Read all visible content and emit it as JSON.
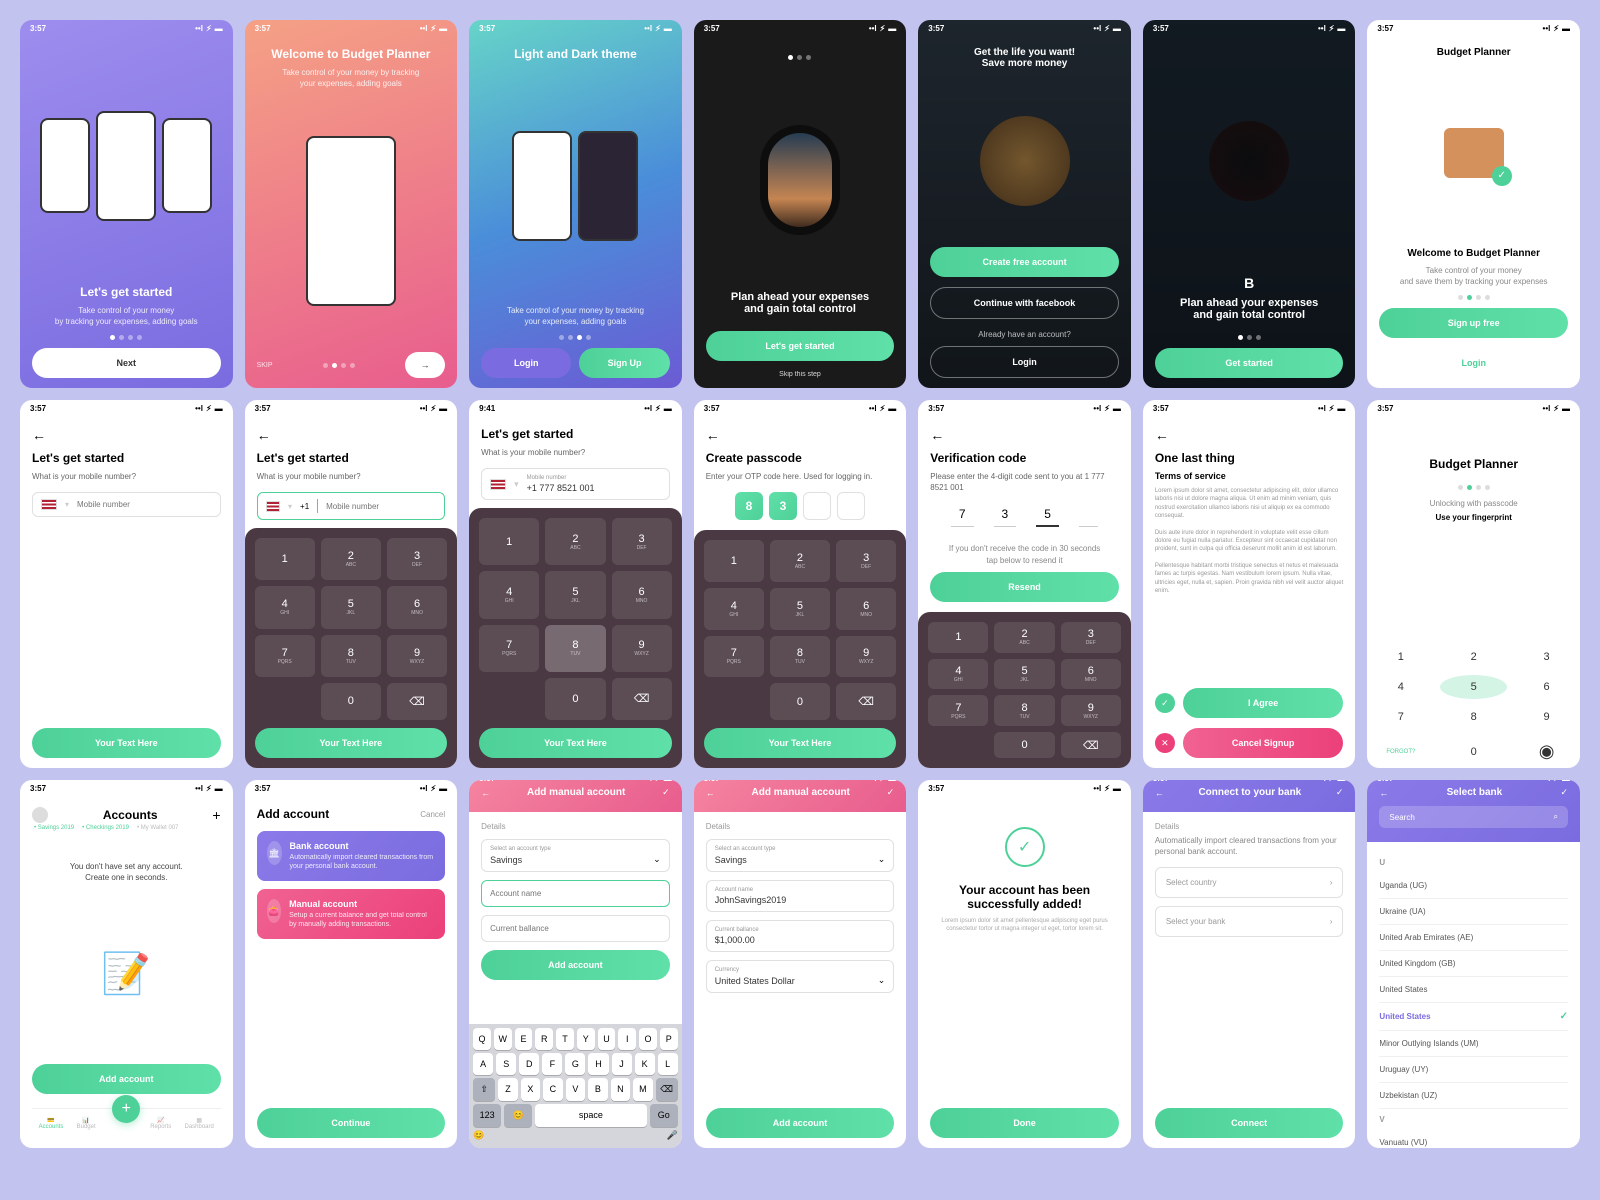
{
  "time": "3:57",
  "time_alt": "9:41",
  "r1": {
    "s1": {
      "title": "Let's get started",
      "subtitle": "Take control of your money\nby tracking your expenses, adding goals",
      "btn": "Next"
    },
    "s2": {
      "title": "Welcome to Budget Planner",
      "subtitle": "Take control of your money by tracking\nyour expenses, adding goals",
      "skip": "SKIP"
    },
    "s3": {
      "title": "Light and Dark theme",
      "subtitle": "Take control of your money by tracking\nyour expenses, adding goals",
      "login": "Login",
      "signup": "Sign Up"
    },
    "s4": {
      "title": "Plan ahead your expenses\nand gain total control",
      "btn": "Let's get started",
      "skip": "Skip this step"
    },
    "s5": {
      "title": "Get the life you want!\nSave more money",
      "btn_create": "Create free account",
      "btn_fb": "Continue with facebook",
      "already": "Already have an account?",
      "login": "Login"
    },
    "s6": {
      "title": "Plan ahead your expenses\nand gain total control",
      "btn": "Get started",
      "letter": "B"
    },
    "s7": {
      "app": "Budget Planner",
      "title": "Welcome to Budget Planner",
      "subtitle": "Take control of your money\nand save them by tracking your expenses",
      "signup": "Sign up free",
      "login": "Login"
    }
  },
  "r2": {
    "s1": {
      "title": "Let's get started",
      "q": "What is your mobile number?",
      "ph": "Mobile number",
      "btn": "Your Text Here"
    },
    "s2": {
      "title": "Let's get started",
      "q": "What is your mobile number?",
      "prefix": "+1",
      "ph": "Mobile number",
      "btn": "Your Text Here"
    },
    "s3": {
      "title": "Let's get started",
      "q": "What is your mobile number?",
      "label": "Mobile number",
      "value": "+1 777 8521 001",
      "btn": "Your Text Here"
    },
    "s4": {
      "title": "Create passcode",
      "subtitle": "Enter your OTP code here. Used for logging in.",
      "d1": "8",
      "d2": "3",
      "btn": "Your Text Here"
    },
    "s5": {
      "title": "Verification code",
      "subtitle": "Please enter the 4-digit code sent to you at 1 777 8521 001",
      "d1": "7",
      "d2": "3",
      "d3": "5",
      "hint": "If you don't receive the code in 30 seconds\ntap below to resend it",
      "btn": "Resend"
    },
    "s6": {
      "title": "One last thing",
      "sub": "Terms of service",
      "agree": "I Agree",
      "cancel": "Cancel Signup",
      "p1": "Lorem ipsum dolor sit amet, consectetur adipiscing elit, dolor ullamco laboris nisi ut dolore magna aliqua. Ut enim ad minim veniam, quis nostrud exercitation ullamco laboris nisi ut aliquip ex ea commodo consequat.",
      "p2": "Duis aute irure dolor in reprehenderit in voluptate velit esse cillum dolore eu fugiat nulla pariatur. Excepteur sint occaecat cupidatat non proident, sunt in culpa qui officia deserunt mollit anim id est laborum.",
      "p3": "Pellentesque habitant morbi tristique senectus et netus et malesuada fames ac turpis egestas. Nam vestibulum lorem ipsum. Nulla vitae, ultricies eget, nulla et, sapien. Proin gravida nibh vel velit auctor aliquet enim."
    },
    "s7": {
      "app": "Budget Planner",
      "hint1": "Unlocking with passcode",
      "hint2": "Use your fingerprint",
      "forgot": "FORGOT?"
    }
  },
  "r3": {
    "s1": {
      "title": "Accounts",
      "empty": "You don't have set any account.\nCreate one in seconds.",
      "btn": "Add account",
      "chip1": "• Savings 2019",
      "chip2": "• Checkings 2019",
      "chip3": "• My Wallet 007",
      "tabs": [
        "Accounts",
        "Budget",
        "Reports",
        "Dashboard"
      ]
    },
    "s2": {
      "title": "Add account",
      "cancel": "Cancel",
      "bank_t": "Bank account",
      "bank_d": "Automatically import cleared transactions from your personal bank account.",
      "manual_t": "Manual account",
      "manual_d": "Setup a current balance and get total control by manually adding transactions.",
      "btn": "Continue"
    },
    "s3": {
      "title": "Add manual account",
      "details": "Details",
      "type_label": "Select an account type",
      "type": "Savings",
      "name_ph": "Account name",
      "bal_ph": "Current ballance",
      "btn": "Add account"
    },
    "s4": {
      "title": "Add manual account",
      "details": "Details",
      "type_label": "Select an account type",
      "type": "Savings",
      "name_label": "Account name",
      "name": "JohnSavings2019",
      "bal_label": "Current ballance",
      "bal": "$1,000.00",
      "cur_label": "Currency",
      "cur": "United States Dollar",
      "btn": "Add account"
    },
    "s5": {
      "title": "Your account has been\nsuccessfully added!",
      "desc": "Lorem ipsum dolor sit amet pellentesque adipiscing eget purus consectetur tortor ut magna integer ut eget, tortor lorem sit.",
      "btn": "Done"
    },
    "s6": {
      "title": "Connect to your bank",
      "details": "Details",
      "desc": "Automatically import cleared transactions from your personal bank account.",
      "country": "Select country",
      "bank": "Select your bank",
      "btn": "Connect"
    },
    "s7": {
      "title": "Select bank",
      "search": "Search",
      "items": [
        "Uganda (UG)",
        "Ukraine (UA)",
        "United Arab Emirates (AE)",
        "United Kingdom (GB)",
        "United States",
        "United States",
        "Minor Outlying Islands (UM)",
        "Uruguay (UY)",
        "Uzbekistan (UZ)",
        "Vanuatu (VU)"
      ]
    }
  },
  "keypad": {
    "1": {
      "n": "1",
      "s": ""
    },
    "2": {
      "n": "2",
      "s": "ABC"
    },
    "3": {
      "n": "3",
      "s": "DEF"
    },
    "4": {
      "n": "4",
      "s": "GHI"
    },
    "5": {
      "n": "5",
      "s": "JKL"
    },
    "6": {
      "n": "6",
      "s": "MNO"
    },
    "7": {
      "n": "7",
      "s": "PQRS"
    },
    "8": {
      "n": "8",
      "s": "TUV"
    },
    "9": {
      "n": "9",
      "s": "WXYZ"
    },
    "0": {
      "n": "0",
      "s": ""
    }
  },
  "kb_r1": [
    "Q",
    "W",
    "E",
    "R",
    "T",
    "Y",
    "U",
    "I",
    "O",
    "P"
  ],
  "kb_r2": [
    "A",
    "S",
    "D",
    "F",
    "G",
    "H",
    "J",
    "K",
    "L"
  ],
  "kb_r3": [
    "Z",
    "X",
    "C",
    "V",
    "B",
    "N",
    "M"
  ],
  "kb_space": "space",
  "kb_123": "123",
  "kb_go": "Go"
}
